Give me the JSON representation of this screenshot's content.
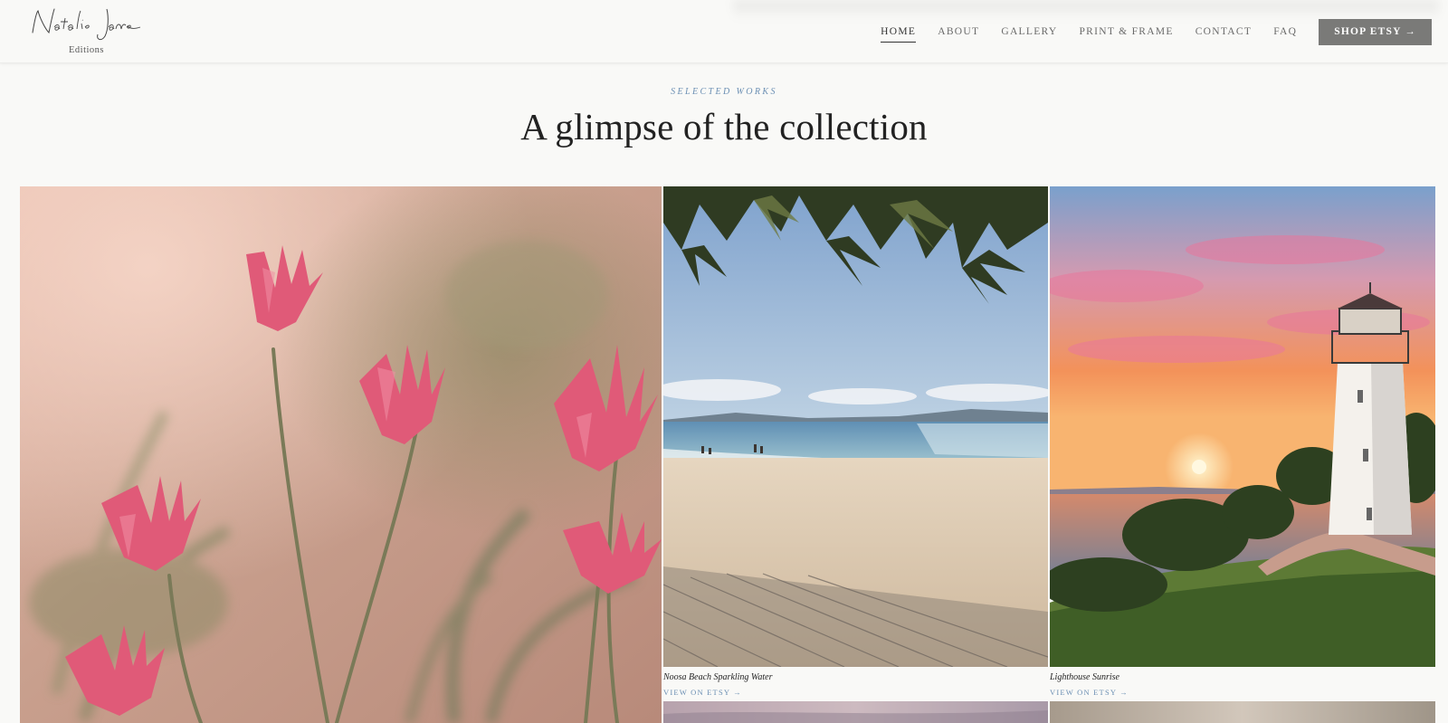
{
  "brand": {
    "script_name": "Natalie Jane",
    "subtitle": "Editions"
  },
  "nav": {
    "items": [
      {
        "label": "HOME",
        "active": true
      },
      {
        "label": "ABOUT",
        "active": false
      },
      {
        "label": "GALLERY",
        "active": false
      },
      {
        "label": "PRINT & FRAME",
        "active": false
      },
      {
        "label": "CONTACT",
        "active": false
      },
      {
        "label": "FAQ",
        "active": false
      }
    ],
    "shop_button": "SHOP ETSY →"
  },
  "hero": {
    "eyebrow": "SELECTED WORKS",
    "title": "A glimpse of the collection"
  },
  "gallery": {
    "items": [
      {
        "title": "",
        "cta": ""
      },
      {
        "title": "Noosa Beach Sparkling Water",
        "cta": "VIEW ON ETSY →"
      },
      {
        "title": "Lighthouse Sunrise",
        "cta": "VIEW ON ETSY →"
      }
    ]
  },
  "colors": {
    "background": "#f9f9f7",
    "accent_blue": "#6b8fb3",
    "button_gray": "#7a7a78",
    "text_dark": "#222222"
  }
}
